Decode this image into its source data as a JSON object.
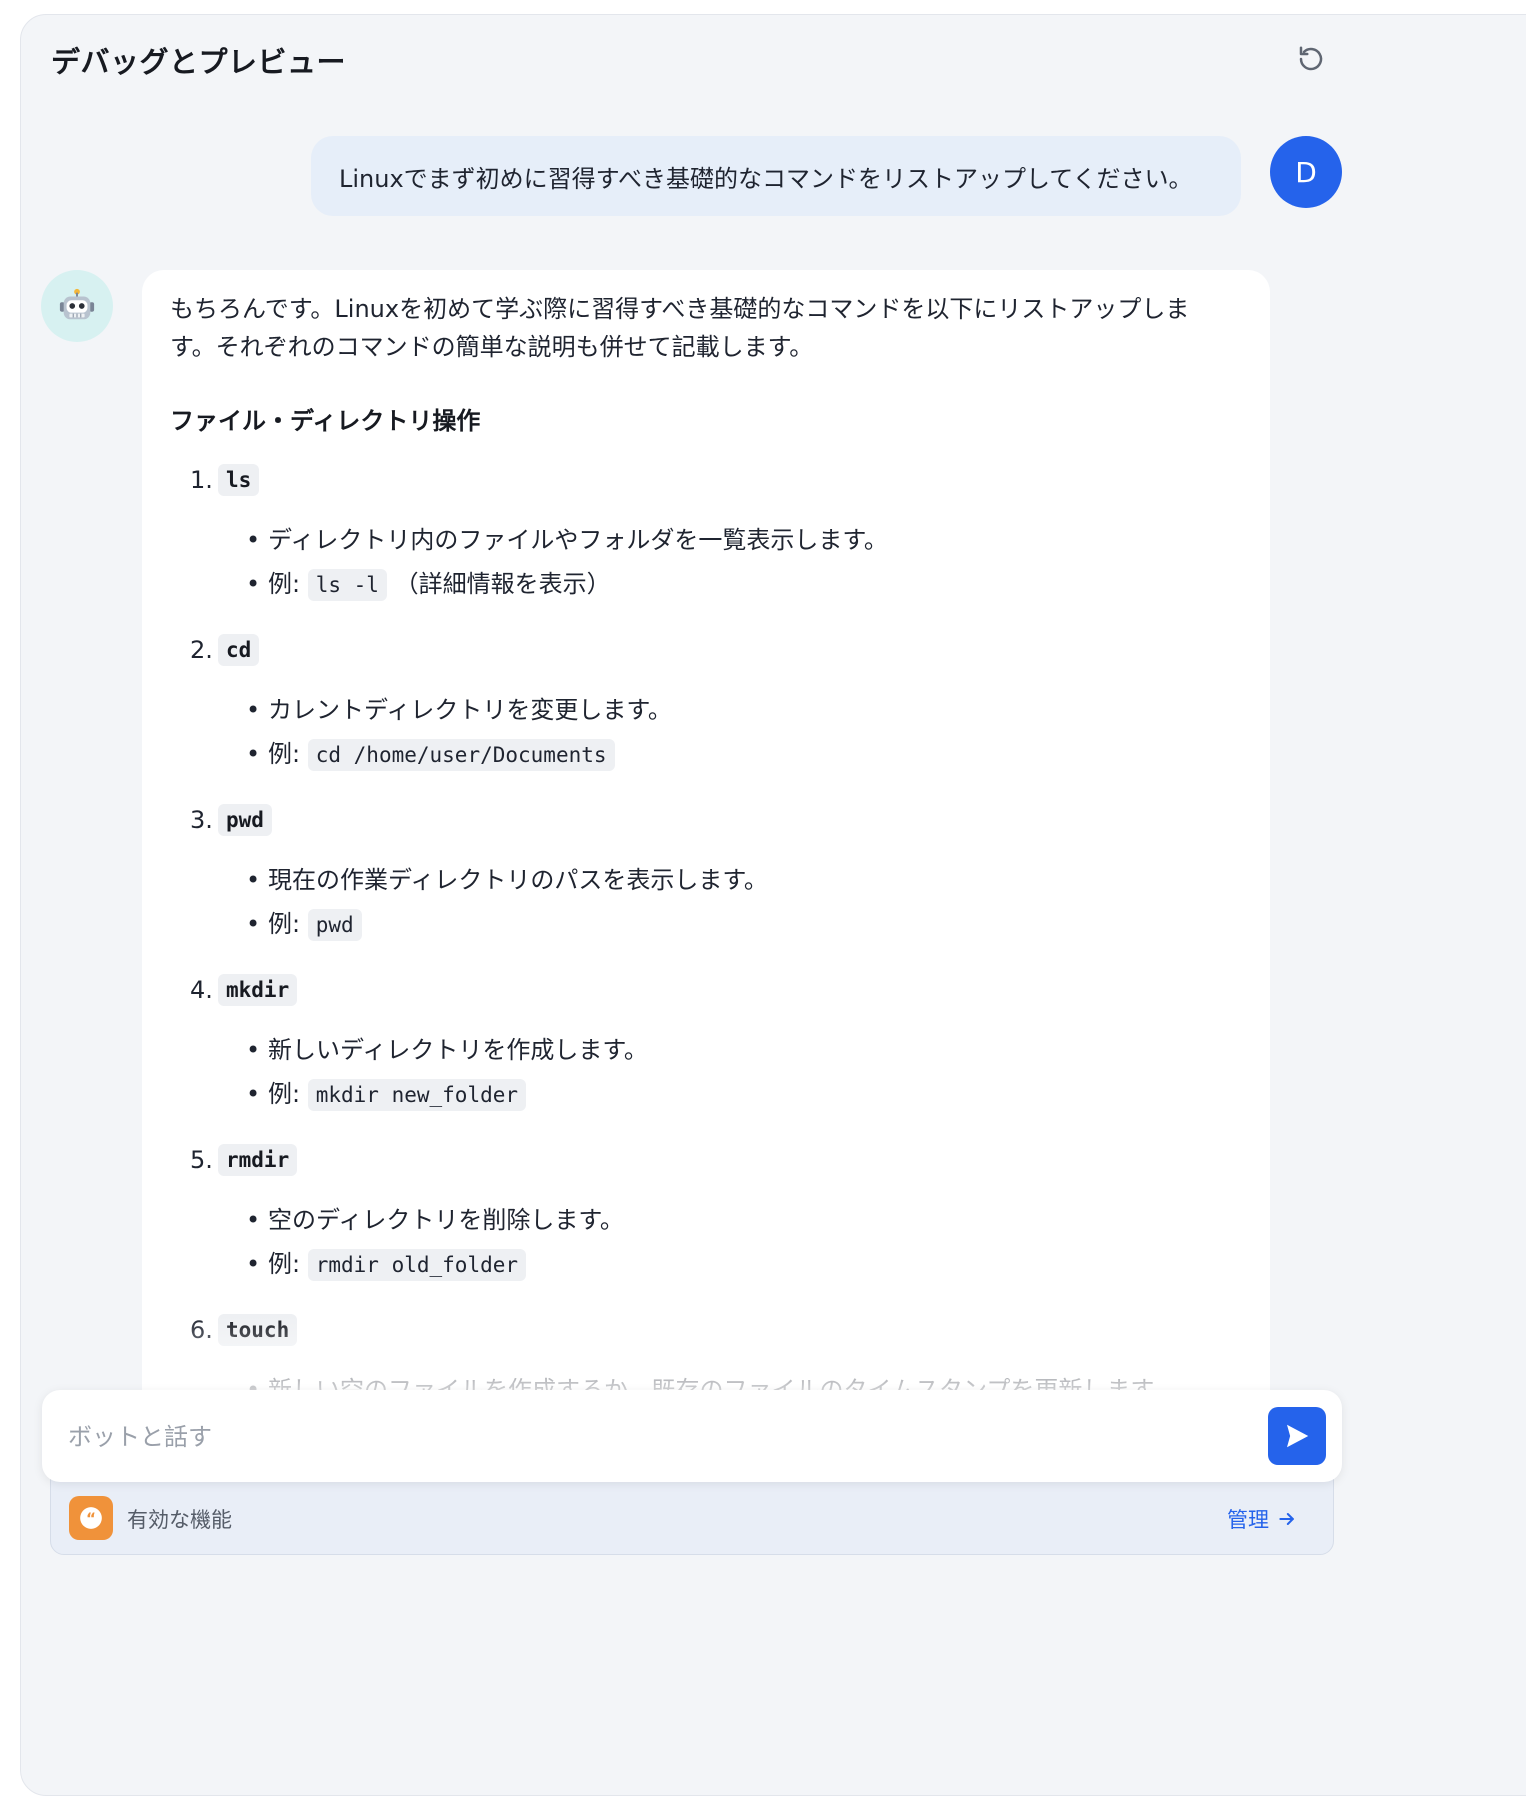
{
  "header": {
    "title": "デバッグとプレビュー"
  },
  "user_message": {
    "avatar_initial": "D",
    "text": "Linuxでまず初めに習得すべき基礎的なコマンドをリストアップしてください。"
  },
  "bot_message": {
    "avatar_icon": "robot-icon",
    "intro_line1": "もちろんです。Linuxを初めて学ぶ際に習得すべき基礎的なコマンドを以下にリストアップしま",
    "intro_line2": "す。それぞれのコマンドの簡単な説明も併せて記載します。",
    "section_heading": "ファイル・ディレクトリ操作",
    "example_prefix": "例:",
    "commands": [
      {
        "num": "1.",
        "name": "ls",
        "desc": "ディレクトリ内のファイルやフォルダを一覧表示します。",
        "example": "ls -l",
        "example_note": "（詳細情報を表示）"
      },
      {
        "num": "2.",
        "name": "cd",
        "desc": "カレントディレクトリを変更します。",
        "example": "cd /home/user/Documents",
        "example_note": ""
      },
      {
        "num": "3.",
        "name": "pwd",
        "desc": "現在の作業ディレクトリのパスを表示します。",
        "example": "pwd",
        "example_note": ""
      },
      {
        "num": "4.",
        "name": "mkdir",
        "desc": "新しいディレクトリを作成します。",
        "example": "mkdir new_folder",
        "example_note": ""
      },
      {
        "num": "5.",
        "name": "rmdir",
        "desc": "空のディレクトリを削除します。",
        "example": "rmdir old_folder",
        "example_note": ""
      },
      {
        "num": "6.",
        "name": "touch",
        "desc": "新しい空のファイルを作成するか、既存のファイルのタイムスタンプを更新します。",
        "example": "",
        "example_note": ""
      }
    ]
  },
  "input": {
    "placeholder": "ボットと話す"
  },
  "features_bar": {
    "label": "有効な機能",
    "manage_label": "管理"
  },
  "colors": {
    "accent": "#2563eb",
    "user_bubble": "#e6eef9",
    "features_icon": "#f0923a"
  }
}
